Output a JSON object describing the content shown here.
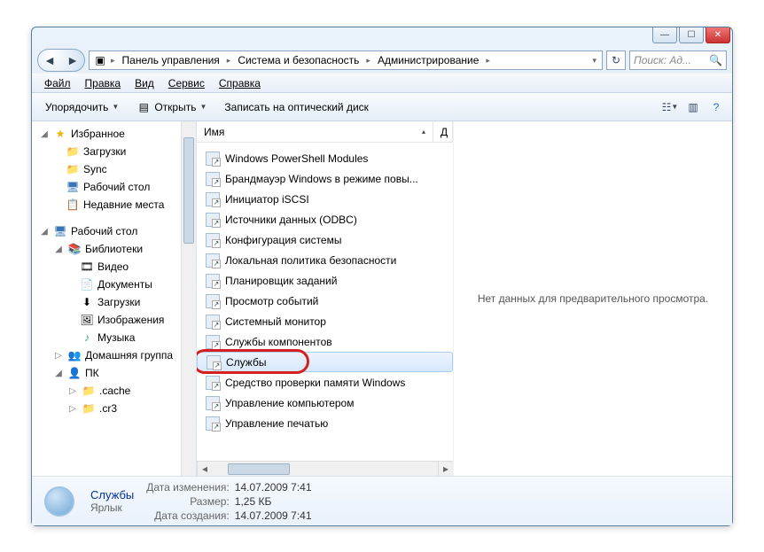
{
  "titlebar": {
    "min": "—",
    "max": "☐",
    "close": "✕"
  },
  "breadcrumbs": [
    "Панель управления",
    "Система и безопасность",
    "Администрирование"
  ],
  "search": {
    "placeholder": "Поиск: Ад..."
  },
  "menu": [
    "Файл",
    "Правка",
    "Вид",
    "Сервис",
    "Справка"
  ],
  "toolbar": {
    "organize": "Упорядочить",
    "open": "Открыть",
    "burn": "Записать на оптический диск"
  },
  "columns": {
    "name": "Имя",
    "date": "Д"
  },
  "nav": {
    "favorites": {
      "label": "Избранное",
      "items": [
        "Загрузки",
        "Sync",
        "Рабочий стол",
        "Недавние места"
      ]
    },
    "desktop": {
      "label": "Рабочий стол"
    },
    "libs": {
      "label": "Библиотеки",
      "items": [
        "Видео",
        "Документы",
        "Загрузки",
        "Изображения",
        "Музыка"
      ]
    },
    "home": {
      "label": "Домашняя группа"
    },
    "pc": {
      "label": "ПК",
      "items": [
        ".cache",
        ".cr3"
      ]
    }
  },
  "files": [
    {
      "name": "Windows PowerShell Modules",
      "d": "1"
    },
    {
      "name": "Брандмауэр Windows в режиме повы...",
      "d": "1"
    },
    {
      "name": "Инициатор iSCSI",
      "d": "1"
    },
    {
      "name": "Источники данных (ODBC)",
      "d": "1"
    },
    {
      "name": "Конфигурация системы",
      "d": "1"
    },
    {
      "name": "Локальная политика безопасности",
      "d": "1"
    },
    {
      "name": "Планировщик заданий",
      "d": "1"
    },
    {
      "name": "Просмотр событий",
      "d": "1"
    },
    {
      "name": "Системный монитор",
      "d": "1"
    },
    {
      "name": "Службы компонентов",
      "d": "1"
    },
    {
      "name": "Службы",
      "d": "1",
      "sel": true,
      "hl": true
    },
    {
      "name": "Средство проверки памяти Windows",
      "d": "1"
    },
    {
      "name": "Управление компьютером",
      "d": "1"
    },
    {
      "name": "Управление печатью",
      "d": "2"
    }
  ],
  "preview": {
    "empty": "Нет данных для предварительного просмотра."
  },
  "details": {
    "title": "Службы",
    "type": "Ярлык",
    "k_modified": "Дата изменения:",
    "v_modified": "14.07.2009 7:41",
    "k_size": "Размер:",
    "v_size": "1,25 КБ",
    "k_created": "Дата создания:",
    "v_created": "14.07.2009 7:41"
  }
}
